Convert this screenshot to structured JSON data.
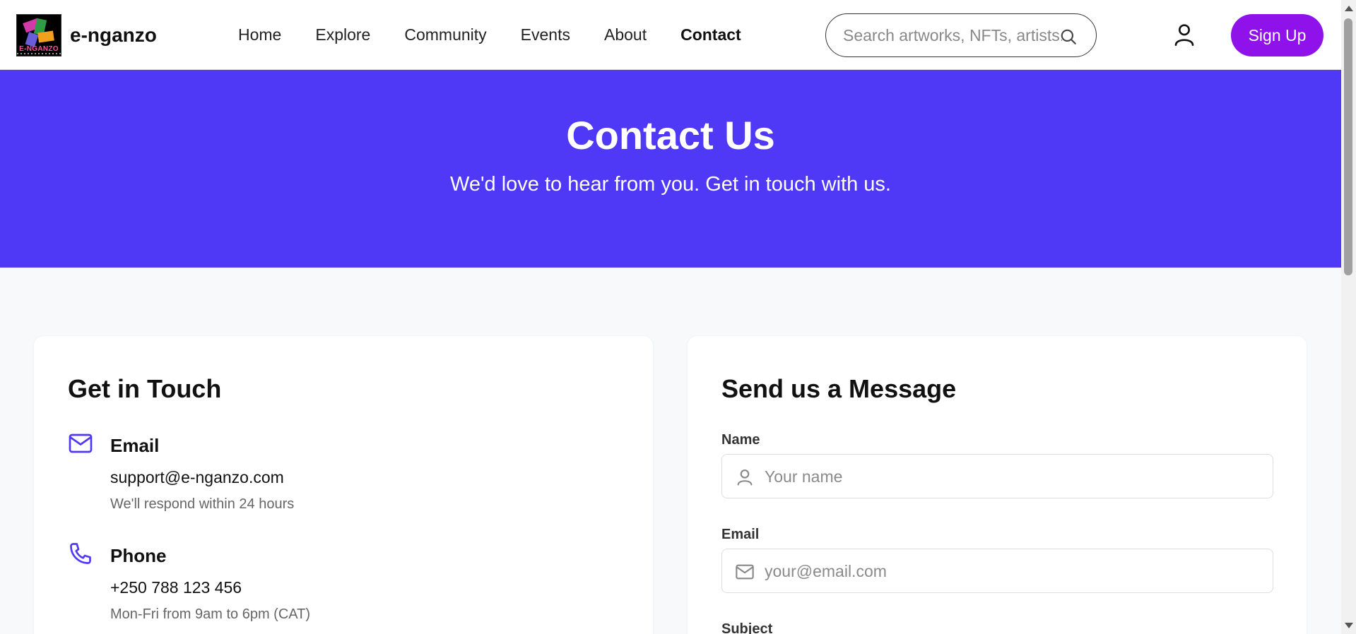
{
  "brand": {
    "name": "e-nganzo",
    "logo_text": "E-NGANZO"
  },
  "nav": {
    "items": [
      {
        "label": "Home"
      },
      {
        "label": "Explore"
      },
      {
        "label": "Community"
      },
      {
        "label": "Events"
      },
      {
        "label": "About"
      },
      {
        "label": "Contact",
        "active": true
      }
    ]
  },
  "search": {
    "placeholder": "Search artworks, NFTs, artists...",
    "value": ""
  },
  "header_actions": {
    "signup_label": "Sign Up"
  },
  "hero": {
    "title": "Contact Us",
    "subtitle": "We'd love to hear from you. Get in touch with us."
  },
  "contact_info": {
    "title": "Get in Touch",
    "items": [
      {
        "icon": "mail-icon",
        "title": "Email",
        "value": "support@e-nganzo.com",
        "note": "We'll respond within 24 hours"
      },
      {
        "icon": "phone-icon",
        "title": "Phone",
        "value": "+250 788 123 456",
        "note": "Mon-Fri from 9am to 6pm (CAT)"
      }
    ]
  },
  "message_form": {
    "title": "Send us a Message",
    "fields": {
      "name": {
        "label": "Name",
        "placeholder": "Your name",
        "icon": "user-icon"
      },
      "email": {
        "label": "Email",
        "placeholder": "your@email.com",
        "icon": "mail-icon"
      },
      "subject": {
        "label": "Subject"
      }
    }
  },
  "colors": {
    "hero_bg": "#4f39f6",
    "signup_bg": "#9012ea",
    "icon_accent": "#4f39f6"
  }
}
